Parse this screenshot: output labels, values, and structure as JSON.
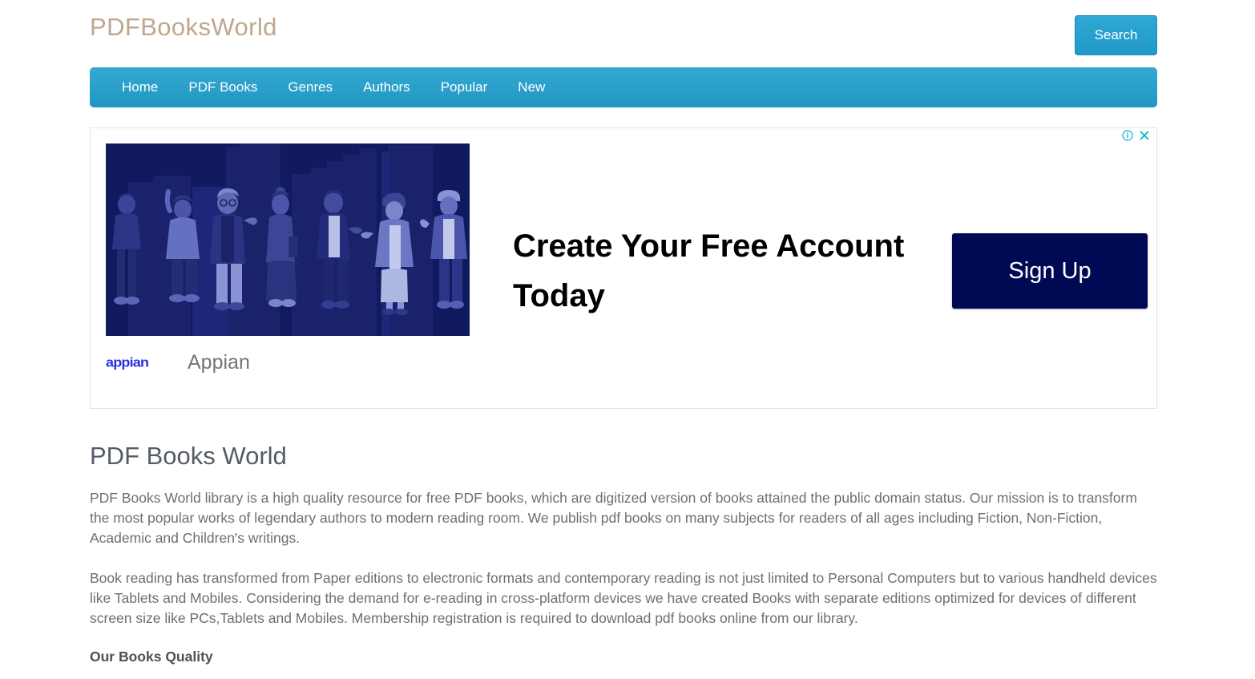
{
  "header": {
    "logo_text": "PDFBooksWorld",
    "search_button_label": "Search"
  },
  "nav": {
    "items": [
      {
        "label": "Home"
      },
      {
        "label": "PDF Books"
      },
      {
        "label": "Genres"
      },
      {
        "label": "Authors"
      },
      {
        "label": "Popular"
      },
      {
        "label": "New"
      }
    ]
  },
  "ad": {
    "info_icon": "info-icon",
    "close_icon": "close-icon",
    "headline": "Create Your Free Account Today",
    "cta_label": "Sign Up",
    "advertiser_logo_text": "appian",
    "advertiser_name": "Appian",
    "colors": {
      "cta_background": "#000a54",
      "illustration_background": "#111a5e",
      "advertiser_logo": "#2a31e0",
      "control_icons": "#00aecd"
    }
  },
  "main": {
    "title": "PDF Books World",
    "paragraphs": [
      "PDF Books World library is a high quality resource for free PDF books, which are digitized version of books attained the public domain status. Our mission is to transform the most popular works of legendary authors to modern reading room. We publish pdf books on many subjects for readers of all ages including Fiction, Non-Fiction, Academic and Children's writings.",
      "Book reading has transformed from Paper editions to electronic formats and contemporary reading is not just limited to Personal Computers but to various handheld devices like Tablets and Mobiles. Considering the demand for e-reading in cross-platform devices we have created Books with separate editions optimized for devices of different screen size like PCs,Tablets and Mobiles. Membership registration is required to download pdf books online from our library."
    ],
    "subheading": "Our Books Quality"
  },
  "theme": {
    "nav_blue": "#2099c3",
    "logo_tan": "#bfa78c",
    "body_text": "#6a7075"
  }
}
